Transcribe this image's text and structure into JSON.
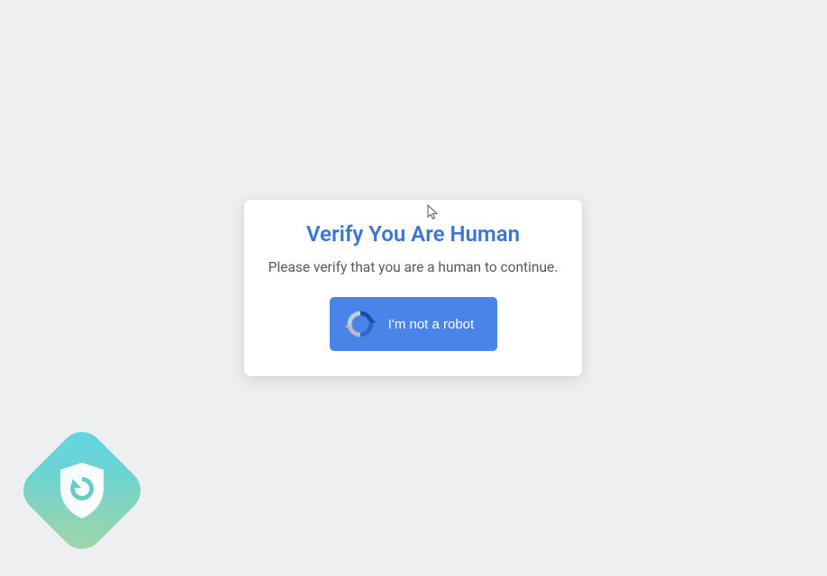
{
  "dialog": {
    "title": "Verify You Are Human",
    "subtitle": "Please verify that you are a human to continue.",
    "button_label": "I'm not a robot"
  }
}
